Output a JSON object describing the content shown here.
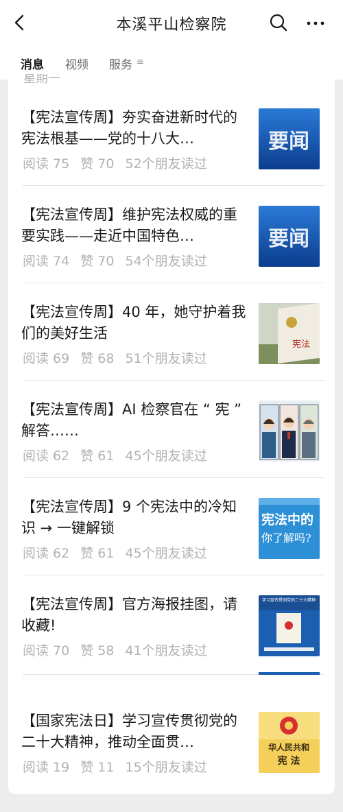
{
  "header": {
    "title": "本溪平山检察院"
  },
  "tabs": [
    {
      "label": "消息",
      "active": true
    },
    {
      "label": "视频",
      "active": false
    },
    {
      "label": "服务",
      "active": false
    }
  ],
  "tab_menu_glyph": "≡",
  "feed": {
    "day_label": "星期一",
    "articles": [
      {
        "title": "【宪法宣传周】夯实奋进新时代的宪法根基——党的十八大…",
        "reads": "阅读 75",
        "likes": "赞 70",
        "friends": "52个朋友读过",
        "thumb_text": "要闻"
      },
      {
        "title": "【宪法宣传周】维护宪法权威的重要实践——走近中国特色…",
        "reads": "阅读 74",
        "likes": "赞 70",
        "friends": "54个朋友读过",
        "thumb_text": "要闻"
      },
      {
        "title": "【宪法宣传周】40 年，她守护着我们的美好生活",
        "reads": "阅读 69",
        "likes": "赞 68",
        "friends": "51个朋友读过",
        "thumb_text": "宪法"
      },
      {
        "title": "【宪法宣传周】AI 检察官在 “ 宪 ” 解答……",
        "reads": "阅读 62",
        "likes": "赞 61",
        "friends": "45个朋友读过",
        "thumb_text": ""
      },
      {
        "title": "【宪法宣传周】9 个宪法中的冷知识 → 一键解锁",
        "reads": "阅读 62",
        "likes": "赞 61",
        "friends": "45个朋友读过",
        "thumb_text": "宪法中的 你了解吗?"
      },
      {
        "title": "【宪法宣传周】官方海报挂图，请收藏!",
        "reads": "阅读 70",
        "likes": "赞 58",
        "friends": "41个朋友读过",
        "thumb_text": "学习宣传贯彻党的二十大精神"
      },
      {
        "title": "【国家宪法日】学习宣传贯彻党的二十大精神，推动全面贯…",
        "reads": "阅读 19",
        "likes": "赞 11",
        "friends": "15个朋友读过",
        "thumb_text": "华人民共和 宪 法"
      }
    ]
  },
  "colors": {
    "background": "#ededed",
    "card": "#ffffff",
    "text": "#191919",
    "meta": "#b2b2b2",
    "thumb_blue": "#1565c0"
  }
}
